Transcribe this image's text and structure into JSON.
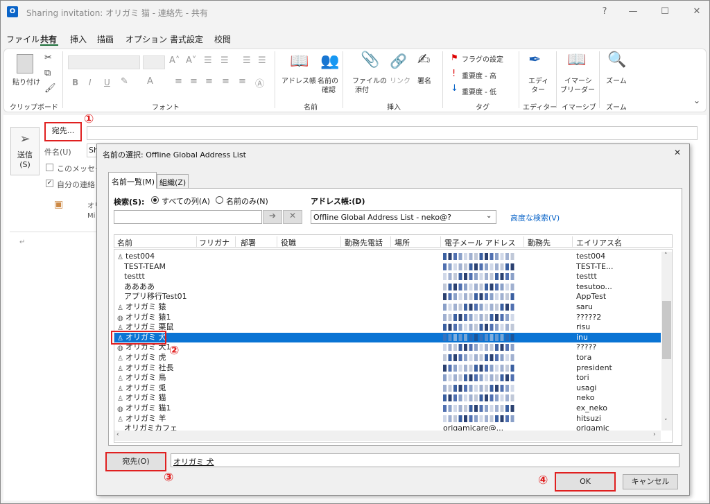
{
  "window": {
    "title": "Sharing invitation: オリガミ 猫 - 連絡先 - 共有",
    "app_icon": "O",
    "controls": [
      "?",
      "—",
      "☐",
      "✕"
    ]
  },
  "menu": [
    "ファイル",
    "共有",
    "挿入",
    "描画",
    "オプション",
    "書式設定",
    "校閲"
  ],
  "ribbon": {
    "paste": "貼り付け",
    "clipboard_group": "クリップボード",
    "font_group": "フォント",
    "font_buttons": [
      "B",
      "I",
      "U"
    ],
    "addressbook": "アドレス帳",
    "checknames_line1": "名前の",
    "checknames_line2": "確認",
    "names_group": "名前",
    "attach_line1": "ファイルの",
    "attach_line2": "添付",
    "link": "リンク",
    "signature": "署名",
    "insert_group": "挿入",
    "flag": "フラグの設定",
    "high": "重要度 - 高",
    "low": "重要度 - 低",
    "tags_group": "タグ",
    "editor_line1": "エディ",
    "editor_line2": "ター",
    "editor_group": "エディター",
    "reader_line1": "イマーシ",
    "reader_line2": "ブリーダー",
    "immersive_group": "イマーシブ",
    "zoom": "ズーム",
    "zoom_group": "ズーム"
  },
  "compose": {
    "send_line1": "送信",
    "send_line2": "(S)",
    "to_button": "宛先...",
    "subject_label": "件名(U)",
    "subject_value": "Sh",
    "check1": "このメッセージ",
    "check2": "自分の連絡",
    "attach_l1": "オリ",
    "attach_l2": "Mi",
    "body_mark": "↵"
  },
  "annotations": [
    "①",
    "②",
    "③",
    "④"
  ],
  "dialog": {
    "title": "名前の選択: Offline Global Address List",
    "close": "✕",
    "tab_names": "名前一覧(M)",
    "tab_org": "組織(Z)",
    "search_label": "検索(S):",
    "radio_all": "すべての列(A)",
    "radio_name": "名前のみ(N)",
    "addressbook_label": "アドレス帳:(D)",
    "addressbook_value": "Offline Global Address List - neko@?",
    "advanced_link": "高度な検索(V)",
    "go_arrow": "➔",
    "clear_x": "✕",
    "columns": [
      "名前",
      "フリガナ",
      "部署",
      "役職",
      "勤務先電話",
      "場所",
      "電子メール アドレス",
      "勤務先",
      "エイリアス名"
    ],
    "rows": [
      {
        "name": "test004",
        "alias": "test004",
        "icon": "person"
      },
      {
        "name": "TEST-TEAM",
        "alias": "TEST-TE...",
        "icon": "none"
      },
      {
        "name": "testtt",
        "alias": "testtt",
        "icon": "none"
      },
      {
        "name": "ああああ",
        "alias": "tesutoo...",
        "icon": "none"
      },
      {
        "name": "アプリ移行Test01",
        "alias": "AppTest",
        "icon": "none"
      },
      {
        "name": "オリガミ 猿",
        "alias": "saru",
        "icon": "person"
      },
      {
        "name": "オリガミ 猿1",
        "alias": "?????2",
        "icon": "globe"
      },
      {
        "name": "オリガミ 栗鼠",
        "alias": "risu",
        "icon": "person"
      },
      {
        "name": "オリガミ 犬",
        "alias": "inu",
        "icon": "person",
        "selected": true
      },
      {
        "name": "オリガミ 犬1",
        "alias": "?????",
        "icon": "globe"
      },
      {
        "name": "オリガミ 虎",
        "alias": "tora",
        "icon": "person"
      },
      {
        "name": "オリガミ 社長",
        "alias": "president",
        "icon": "person"
      },
      {
        "name": "オリガミ 鳥",
        "alias": "tori",
        "icon": "person"
      },
      {
        "name": "オリガミ 兎",
        "alias": "usagi",
        "icon": "person"
      },
      {
        "name": "オリガミ 猫",
        "alias": "neko",
        "icon": "person"
      },
      {
        "name": "オリガミ 猫1",
        "alias": "ex_neko",
        "icon": "globe"
      },
      {
        "name": "オリガミ 羊",
        "alias": "hitsuzi",
        "icon": "person"
      },
      {
        "name": "オリガミカフェ",
        "alias": "origamic",
        "icon": "none",
        "mail": "origamicare@..."
      }
    ],
    "to_button": "宛先(O)",
    "to_value": "オリガミ 犬",
    "ok": "OK",
    "cancel": "キャンセル"
  }
}
